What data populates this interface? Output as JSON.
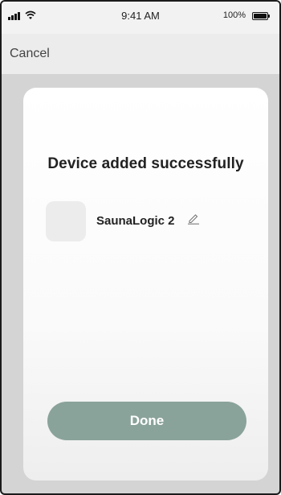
{
  "status_bar": {
    "time": "9:41 AM",
    "battery_percent": "100%",
    "icons": [
      "signal-icon",
      "wifi-icon",
      "battery-icon"
    ]
  },
  "header": {
    "cancel_label": "Cancel"
  },
  "card": {
    "title": "Device added successfully",
    "device": {
      "name": "SaunaLogic 2",
      "icon": "pencil-icon"
    },
    "done_label": "Done"
  },
  "colors": {
    "accent_button": "#8aa39a",
    "background": "#d4d4d4",
    "card": "#f6f6f6"
  }
}
